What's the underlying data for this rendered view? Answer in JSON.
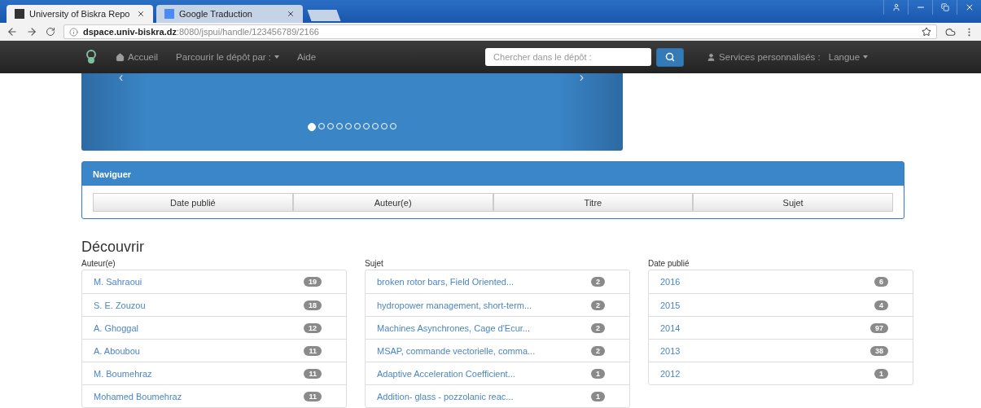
{
  "browser": {
    "tabs": [
      {
        "title": "University of Biskra Repo",
        "selected": true
      },
      {
        "title": "Google Traduction",
        "selected": false
      }
    ],
    "address": "**dspace.univ-biskra.dz**:8080/jspui/handle/123456789/2166"
  },
  "navbar": {
    "items": [
      {
        "label": "Accueil",
        "kind": "home"
      },
      {
        "label": "Parcourir le dépôt par :",
        "kind": "dropdown"
      },
      {
        "label": "Aide",
        "kind": "plain"
      }
    ],
    "search": {
      "placeholder": "Chercher dans le dépôt :"
    },
    "right_items": [
      {
        "label": "Services personnalisés :",
        "kind": "user"
      },
      {
        "label": "Langue",
        "kind": "dropdown"
      }
    ]
  },
  "carousel": {
    "prev": "‹",
    "next": "›",
    "dots": [
      {
        "selected": true
      },
      {
        "selected": false
      },
      {
        "selected": false
      },
      {
        "selected": false
      },
      {
        "selected": false
      },
      {
        "selected": false
      },
      {
        "selected": false
      },
      {
        "selected": false
      },
      {
        "selected": false
      },
      {
        "selected": false
      }
    ]
  },
  "browse_panel": {
    "title": "Naviguer",
    "buttons": [
      "Date publié",
      "Auteur(e)",
      "Titre",
      "Sujet"
    ]
  },
  "discover": {
    "title": "Découvrir",
    "facets": [
      {
        "title": "Auteur(e)",
        "items": [
          {
            "label": "M. Sahraoui",
            "count": "19"
          },
          {
            "label": "S. E. Zouzou",
            "count": "18"
          },
          {
            "label": "A. Ghoggal",
            "count": "12"
          },
          {
            "label": "A. Aboubou",
            "count": "11"
          },
          {
            "label": "M. Boumehraz",
            "count": "11"
          },
          {
            "label": "Mohamed Boumehraz",
            "count": "11"
          }
        ]
      },
      {
        "title": "Sujet",
        "items": [
          {
            "label": "broken rotor bars, Field Oriented...",
            "count": "2"
          },
          {
            "label": "hydropower management, short-term...",
            "count": "2"
          },
          {
            "label": "Machines Asynchrones, Cage d'Ecur...",
            "count": "2"
          },
          {
            "label": "MSAP, commande vectorielle, comma...",
            "count": "2"
          },
          {
            "label": "Adaptive Acceleration Coefficient...",
            "count": "1"
          },
          {
            "label": "Addition- glass - pozzolanic reac...",
            "count": "1"
          }
        ]
      },
      {
        "title": "Date publié",
        "items": [
          {
            "label": "2016",
            "count": "6"
          },
          {
            "label": "2015",
            "count": "4"
          },
          {
            "label": "2014",
            "count": "97"
          },
          {
            "label": "2013",
            "count": "38"
          },
          {
            "label": "2012",
            "count": "1"
          }
        ]
      }
    ]
  }
}
